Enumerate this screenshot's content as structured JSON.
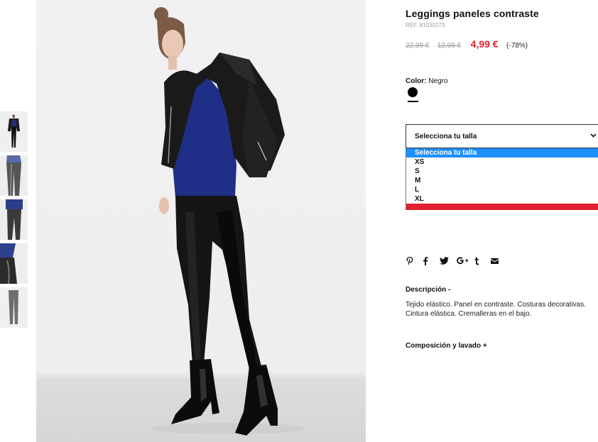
{
  "product": {
    "title": "Leggings paneles contraste",
    "ref": "REF. 81030273",
    "price_original": "22,99 €",
    "price_previous": "12,99 €",
    "price_current": "4,99 €",
    "discount": "(-78%)",
    "sale_color": "#e3202f"
  },
  "color": {
    "label": "Color:",
    "value": "Negro",
    "swatch": "#000000"
  },
  "size": {
    "placeholder": "Selecciona tu talla",
    "chevron_icon": "chevron-down-icon",
    "options": [
      "Selecciona tu talla",
      "XS",
      "S",
      "M",
      "L",
      "XL"
    ],
    "selected_index": 0,
    "highlight_color": "#1e90ff"
  },
  "share": {
    "icons": [
      "pinterest-icon",
      "facebook-icon",
      "twitter-icon",
      "google-plus-icon",
      "tumblr-icon",
      "email-icon"
    ]
  },
  "description": {
    "title": "Descripción  -",
    "text": "Tejido elástico. Panel en contraste. Costuras decorativas. Cintura elástica. Cremalleras en el bajo."
  },
  "composition": {
    "title": "Composición y lavado  +"
  }
}
